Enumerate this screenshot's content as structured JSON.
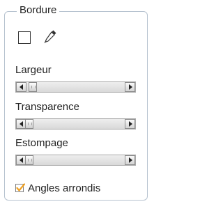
{
  "group": {
    "title": "Bordure"
  },
  "color": {
    "swatch_color": "#ffffff",
    "eyedropper_icon": "eyedropper-icon"
  },
  "sliders": [
    {
      "label": "Largeur",
      "value_fraction": 0.0
    },
    {
      "label": "Transparence",
      "value_fraction": 0.0
    },
    {
      "label": "Estompage",
      "value_fraction": 0.0
    }
  ],
  "rounded_corners": {
    "label": "Angles arrondis",
    "checked": true,
    "check_color": "#f0a020"
  },
  "icons": {
    "scroll_left": "arrow-left-icon",
    "scroll_right": "arrow-right-icon"
  }
}
